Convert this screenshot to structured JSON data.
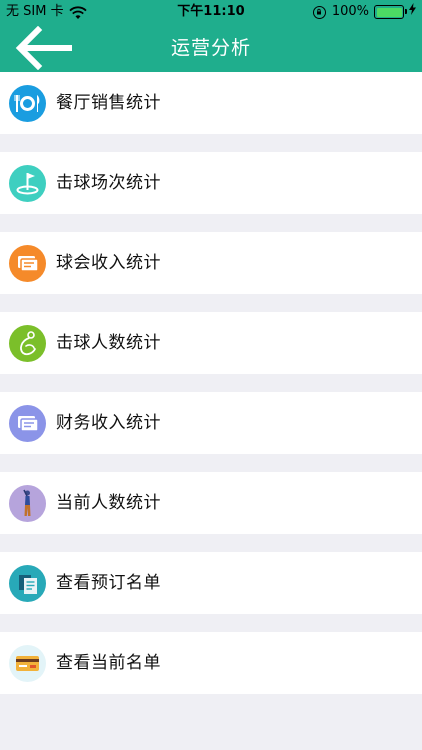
{
  "status_bar": {
    "carrier": "无 SIM 卡",
    "time": "下午11:10",
    "battery": "100%"
  },
  "nav": {
    "title": "运营分析"
  },
  "menu": {
    "items": [
      {
        "label": "餐厅销售统计",
        "icon": "restaurant-icon",
        "color": "#1a9de0"
      },
      {
        "label": "击球场次统计",
        "icon": "golf-flag-icon",
        "color": "#3ecfc0"
      },
      {
        "label": "球会收入统计",
        "icon": "cash-icon",
        "color": "#f58a2a"
      },
      {
        "label": "击球人数统计",
        "icon": "golfer-swing-icon",
        "color": "#7bbf2a"
      },
      {
        "label": "财务收入统计",
        "icon": "finance-icon",
        "color": "#8b94e8"
      },
      {
        "label": "当前人数统计",
        "icon": "player-icon",
        "color": "#b6a4dc"
      },
      {
        "label": "查看预订名单",
        "icon": "booking-list-icon",
        "color": "#28a9b8"
      },
      {
        "label": "查看当前名单",
        "icon": "card-icon",
        "color": "#e3f4f8"
      }
    ]
  }
}
